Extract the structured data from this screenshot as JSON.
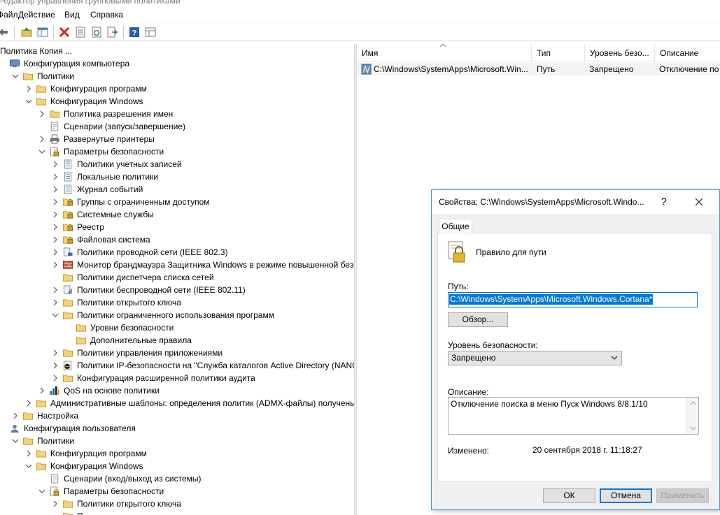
{
  "window": {
    "title": "Редактор управления групповыми политиками"
  },
  "menu": [
    "Файл",
    "Действие",
    "Вид",
    "Справка"
  ],
  "toolbar_icons": [
    "back-arrow-icon",
    "up-folder-icon",
    "show-hide-tree-icon",
    "delete-icon",
    "properties-icon",
    "refresh-icon",
    "export-icon",
    "help-icon",
    "view-icon"
  ],
  "tree": [
    {
      "label": "Политика Копия ...",
      "indent": 0,
      "chev": "",
      "icon": "none"
    },
    {
      "label": "Конфигурация компьютера",
      "indent": 0,
      "chev": "",
      "icon": "computer-icon"
    },
    {
      "label": "Политики",
      "indent": 1,
      "chev": "open",
      "icon": "folder-icon"
    },
    {
      "label": "Конфигурация программ",
      "indent": 2,
      "chev": "closed",
      "icon": "folder-icon"
    },
    {
      "label": "Конфигурация Windows",
      "indent": 2,
      "chev": "open",
      "icon": "folder-icon"
    },
    {
      "label": "Политика разрешения имен",
      "indent": 3,
      "chev": "closed",
      "icon": "folder-icon"
    },
    {
      "label": "Сценарии (запуск/завершение)",
      "indent": 3,
      "chev": "",
      "icon": "script-icon"
    },
    {
      "label": "Развернутые принтеры",
      "indent": 3,
      "chev": "closed",
      "icon": "printer-icon"
    },
    {
      "label": "Параметры безопасности",
      "indent": 3,
      "chev": "open",
      "icon": "security-settings-icon"
    },
    {
      "label": "Политики учетных записей",
      "indent": 4,
      "chev": "closed",
      "icon": "policy-doc-icon"
    },
    {
      "label": "Локальные политики",
      "indent": 4,
      "chev": "closed",
      "icon": "policy-doc-icon"
    },
    {
      "label": "Журнал событий",
      "indent": 4,
      "chev": "closed",
      "icon": "policy-doc-icon"
    },
    {
      "label": "Группы с ограниченным доступом",
      "indent": 4,
      "chev": "closed",
      "icon": "locked-folder-icon"
    },
    {
      "label": "Системные службы",
      "indent": 4,
      "chev": "closed",
      "icon": "locked-folder-icon"
    },
    {
      "label": "Реестр",
      "indent": 4,
      "chev": "closed",
      "icon": "locked-folder-icon"
    },
    {
      "label": "Файловая система",
      "indent": 4,
      "chev": "closed",
      "icon": "locked-folder-icon"
    },
    {
      "label": "Политики проводной сети (IEEE 802.3)",
      "indent": 4,
      "chev": "closed",
      "icon": "network-icon"
    },
    {
      "label": "Монитор брандмауэра Защитника Windows в режиме повышенной безопасности",
      "indent": 4,
      "chev": "closed",
      "icon": "firewall-icon"
    },
    {
      "label": "Политики диспетчера списка сетей",
      "indent": 4,
      "chev": "",
      "icon": "folder-icon"
    },
    {
      "label": "Политики беспроводной сети (IEEE 802.11)",
      "indent": 4,
      "chev": "closed",
      "icon": "wireless-icon"
    },
    {
      "label": "Политики открытого ключа",
      "indent": 4,
      "chev": "closed",
      "icon": "folder-icon"
    },
    {
      "label": "Политики ограниченного использования программ",
      "indent": 4,
      "chev": "open",
      "icon": "folder-icon"
    },
    {
      "label": "Уровни безопасности",
      "indent": 5,
      "chev": "",
      "icon": "folder-icon"
    },
    {
      "label": "Дополнительные правила",
      "indent": 5,
      "chev": "",
      "icon": "folder-icon"
    },
    {
      "label": "Политики управления приложениями",
      "indent": 4,
      "chev": "closed",
      "icon": "folder-icon"
    },
    {
      "label": "Политики IP-безопасности на \"Служба каталогов Active Directory (NANOLE",
      "indent": 4,
      "chev": "closed",
      "icon": "ipsec-icon"
    },
    {
      "label": "Конфигурация расширенной политики аудита",
      "indent": 4,
      "chev": "closed",
      "icon": "folder-icon"
    },
    {
      "label": "QoS на основе политики",
      "indent": 3,
      "chev": "closed",
      "icon": "qos-chart-icon"
    },
    {
      "label": "Административные шаблоны: определения политик (ADMX-файлы) получены из",
      "indent": 2,
      "chev": "closed",
      "icon": "folder-icon"
    },
    {
      "label": "Настройка",
      "indent": 1,
      "chev": "closed",
      "icon": "folder-icon"
    },
    {
      "label": "Конфигурация пользователя",
      "indent": 0,
      "chev": "",
      "icon": "user-icon"
    },
    {
      "label": "Политики",
      "indent": 1,
      "chev": "open",
      "icon": "folder-icon"
    },
    {
      "label": "Конфигурация программ",
      "indent": 2,
      "chev": "closed",
      "icon": "folder-icon"
    },
    {
      "label": "Конфигурация Windows",
      "indent": 2,
      "chev": "open",
      "icon": "folder-icon"
    },
    {
      "label": "Сценарии (вход/выход из системы)",
      "indent": 3,
      "chev": "",
      "icon": "script-icon"
    },
    {
      "label": "Параметры безопасности",
      "indent": 3,
      "chev": "open",
      "icon": "security-settings-icon"
    },
    {
      "label": "Политики открытого ключа",
      "indent": 4,
      "chev": "closed",
      "icon": "folder-icon"
    },
    {
      "label": "П",
      "indent": 4,
      "chev": "",
      "icon": "folder-icon"
    }
  ],
  "list": {
    "columns": [
      "Имя",
      "Тип",
      "Уровень безо...",
      "Описание"
    ],
    "rows": [
      {
        "name": "C:\\Windows\\SystemApps\\Microsoft.Win...",
        "type": "Путь",
        "level": "Запрещено",
        "desc": "Отключение по"
      }
    ]
  },
  "dialog": {
    "title": "Свойства: C:\\Windows\\SystemApps\\Microsoft.Windo...",
    "help": "?",
    "tab": "Общие",
    "rule_label": "Правило для пути",
    "path_label": "Путь:",
    "path_value": "C:\\Windows\\SystemApps\\Microsoft.Windows.Cortana*",
    "browse": "Обзор...",
    "level_label": "Уровень безопасности:",
    "level_value": "Запрещено",
    "desc_label": "Описание:",
    "desc_value": "Отключение поиска в меню Пуск Windows 8/8.1/10",
    "modified_label": "Изменено:",
    "modified_value": "20 сентября 2018 г.  11:18:27",
    "ok": "ОК",
    "cancel": "Отмена",
    "apply": "Применить"
  },
  "colors": {
    "accent": "#0078d7",
    "selection_row": "#f3f3f3",
    "dialog_bg": "#f0f0f0"
  }
}
